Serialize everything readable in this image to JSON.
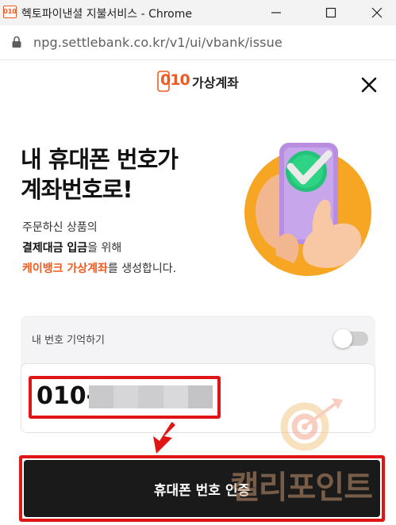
{
  "window": {
    "title": "헥토파이낸셜 지불서비스 - Chrome",
    "app_icon_text": "010",
    "icons": [
      "app-icon",
      "minimize-icon",
      "maximize-icon",
      "close-icon"
    ]
  },
  "address_bar": {
    "url": "npg.settlebank.co.kr/v1/ui/vbank/issue",
    "icon": "lock-icon"
  },
  "header": {
    "brand_digits": "010",
    "brand_text": "가상계좌",
    "close_icon": "close-icon"
  },
  "hero": {
    "title_line1": "내 휴대폰 번호가",
    "title_line2": "계좌번호로!",
    "desc_line1": "주문하신 상품의",
    "desc_line2_bold": "결제대금 입금",
    "desc_line2_rest": "을 위해",
    "desc_line3_accent": "케이뱅크 가상계좌",
    "desc_line3_rest": "를 생성합니다.",
    "illustration": "hand-phone-check-illustration"
  },
  "form": {
    "remember_label": "내 번호 기억하기",
    "remember_on": false,
    "phone_prefix": "010-",
    "phone_masked": true
  },
  "overlay": {
    "watermark_text": "캘리포인트",
    "watermark_icon": "target-arrow-icon",
    "arrow_icon": "down-arrow-icon",
    "highlight_color": "#e01616"
  },
  "cta": {
    "label": "휴대폰 번호 인증"
  },
  "colors": {
    "accent": "#f05a22",
    "cta_bg": "#1a1a1a",
    "card_bg": "#f4f4f6"
  }
}
